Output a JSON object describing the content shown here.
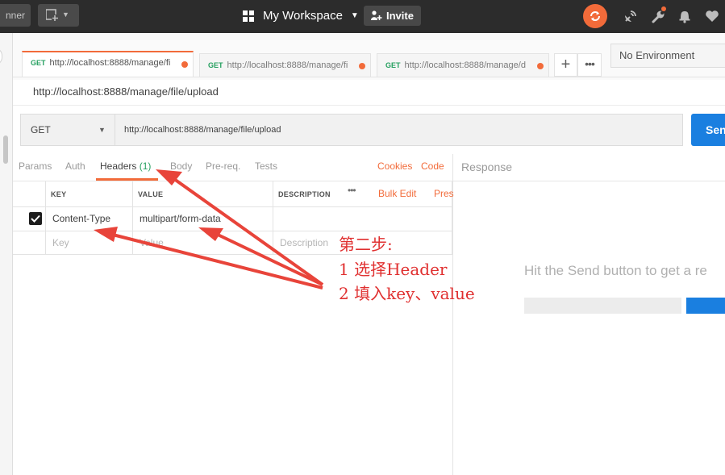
{
  "topbar": {
    "runner_label": "nner",
    "workspace_label": "My Workspace",
    "invite_label": "Invite"
  },
  "tabs": [
    {
      "method": "GET",
      "url": "http://localhost:8888/manage/fi"
    },
    {
      "method": "GET",
      "url": "http://localhost:8888/manage/fi"
    },
    {
      "method": "GET",
      "url": "http://localhost:8888/manage/d"
    }
  ],
  "environment": "No Environment",
  "request": {
    "title": "http://localhost:8888/manage/file/upload",
    "method": "GET",
    "url": "http://localhost:8888/manage/file/upload",
    "send_label": "Sen"
  },
  "subtabs": {
    "params": "Params",
    "auth": "Auth",
    "headers": "Headers",
    "headers_count": "(1)",
    "body": "Body",
    "prereq": "Pre-req.",
    "tests": "Tests",
    "cookies": "Cookies",
    "code": "Code"
  },
  "headers_table": {
    "col_key": "KEY",
    "col_value": "VALUE",
    "col_description": "DESCRIPTION",
    "bulk_edit": "Bulk Edit",
    "presets": "Pres",
    "row": {
      "key": "Content-Type",
      "value": "multipart/form-data"
    },
    "placeholder": {
      "key": "Key",
      "value": "Value",
      "description": "Description"
    }
  },
  "response": {
    "label": "Response",
    "hint": "Hit the Send button to get a re"
  },
  "annotation": {
    "line1": "第二步:",
    "line2": "1 选择Header",
    "line3": "2 填入key、value"
  },
  "colors": {
    "accent": "#f26b3a",
    "send_blue": "#1a7fe0",
    "method_green": "#26a060",
    "annotation_red": "#e03030"
  }
}
